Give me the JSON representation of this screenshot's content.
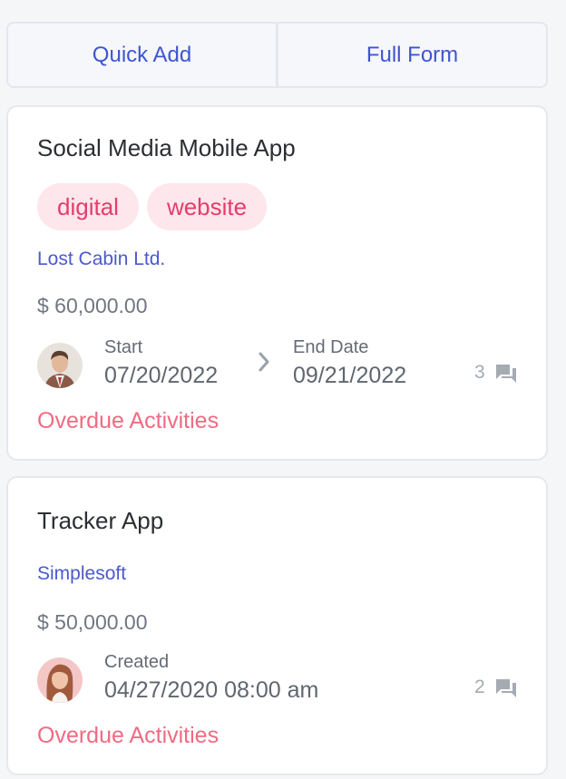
{
  "toolbar": {
    "quick_add_label": "Quick Add",
    "full_form_label": "Full Form"
  },
  "cards": [
    {
      "title": "Social Media Mobile App",
      "tags": [
        "digital",
        "website"
      ],
      "company": "Lost Cabin Ltd.",
      "amount": "$ 60,000.00",
      "start_label": "Start",
      "start_value": "07/20/2022",
      "end_label": "End Date",
      "end_value": "09/21/2022",
      "comment_count": "3",
      "status": "Overdue Activities",
      "avatar_icon": "man-in-suit-avatar"
    },
    {
      "title": "Tracker App",
      "company": "Simplesoft",
      "amount": "$ 50,000.00",
      "created_label": "Created",
      "created_value": "04/27/2020 08:00 am",
      "comment_count": "2",
      "status": "Overdue Activities",
      "avatar_icon": "woman-avatar"
    }
  ],
  "colors": {
    "accent": "#3f55cf",
    "tag_bg": "#fde6ec",
    "tag_text": "#e33d6a",
    "overdue": "#ef6b83"
  }
}
